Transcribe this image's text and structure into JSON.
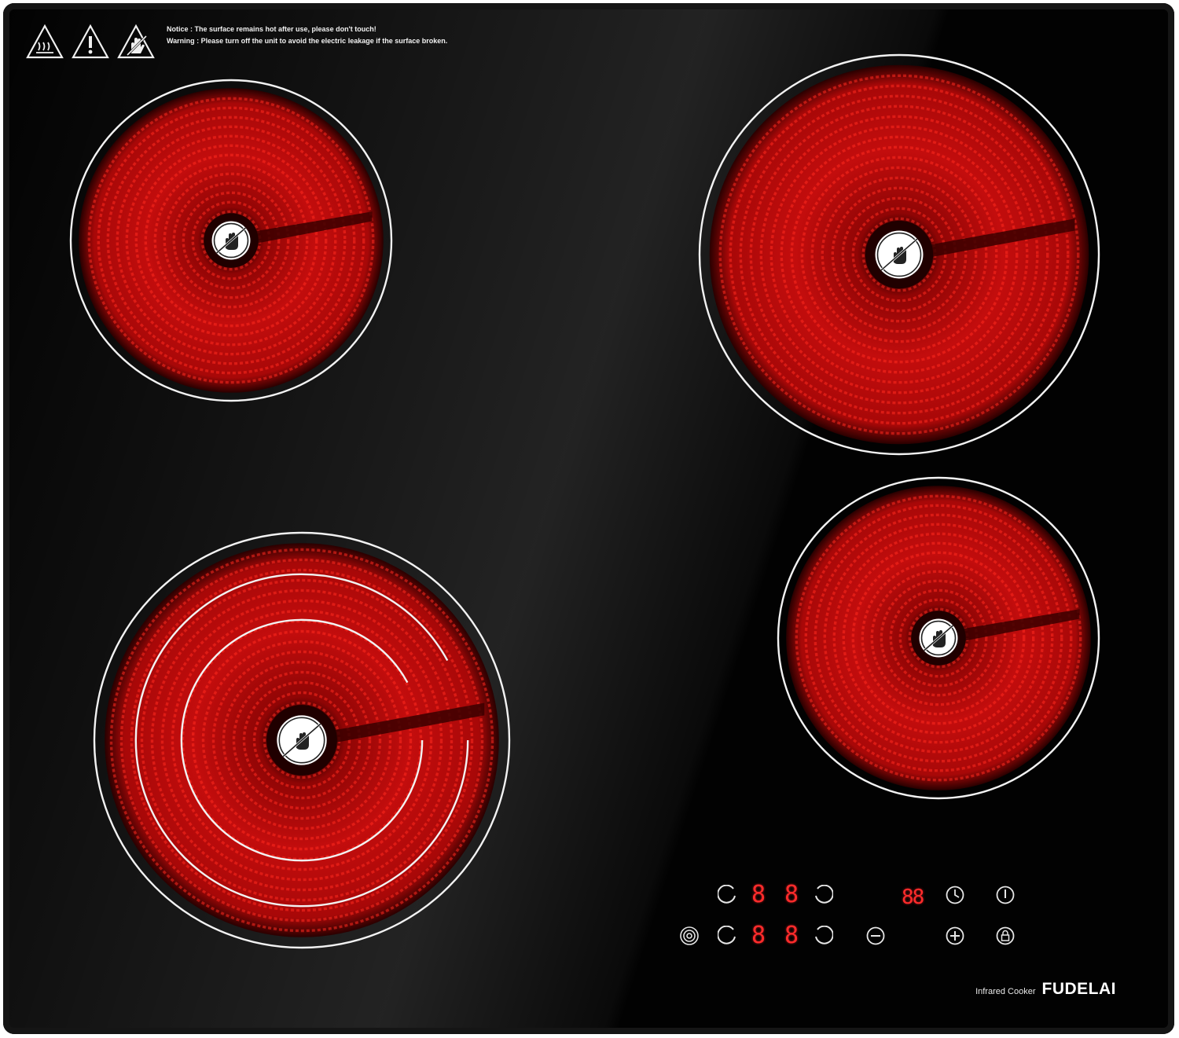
{
  "notice": {
    "line1": "Notice :  The surface remains hot after use, please don't touch!",
    "line2": "Warning :  Please turn off the unit to avoid the electric leakage if the surface broken."
  },
  "warning_icons": [
    "hot-surface-icon",
    "exclamation-icon",
    "no-touch-hand-icon"
  ],
  "zones": [
    {
      "name": "zone-top-left",
      "icon": "no-touch-hand-icon",
      "rings": 1
    },
    {
      "name": "zone-top-right",
      "icon": "no-touch-hand-icon",
      "rings": 1
    },
    {
      "name": "zone-bottom-left",
      "icon": "no-touch-hand-icon",
      "rings": 3
    },
    {
      "name": "zone-bottom-right",
      "icon": "no-touch-hand-icon",
      "rings": 1
    }
  ],
  "control_panel": {
    "zone_displays": [
      "8",
      "8",
      "8",
      "8"
    ],
    "timer_display": "88",
    "buttons": [
      "zone-select",
      "zone-select",
      "zone-select",
      "zone-select",
      "minus",
      "plus",
      "timer",
      "power",
      "lock",
      "dual-zone"
    ]
  },
  "brand": {
    "sub": "Infrared Cooker",
    "main": "FUDELAI"
  },
  "colors": {
    "glass": "#020202",
    "heat": "#d10f0f",
    "led": "#ff2b2b",
    "ring": "#f2f2f2"
  }
}
